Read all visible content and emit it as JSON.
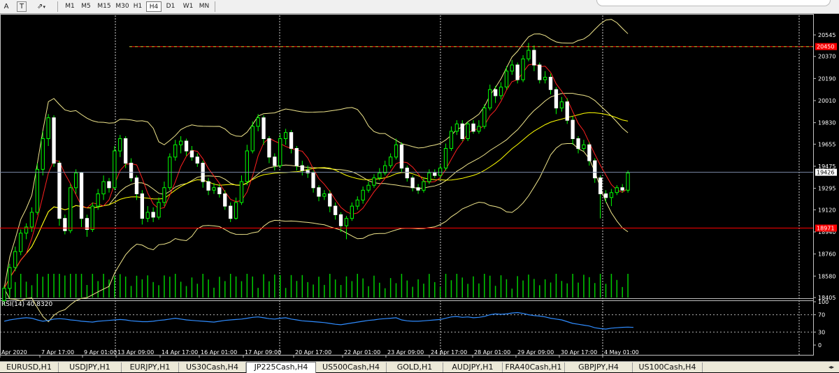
{
  "toolbar": {
    "tools": [
      {
        "name": "text-tool",
        "glyph": "A"
      },
      {
        "name": "text-label-tool",
        "glyph": "T"
      },
      {
        "name": "arrows-tool",
        "glyph": "⇗"
      }
    ],
    "timeframes": [
      {
        "label": "M1",
        "active": false
      },
      {
        "label": "M5",
        "active": false
      },
      {
        "label": "M15",
        "active": false
      },
      {
        "label": "M30",
        "active": false
      },
      {
        "label": "H1",
        "active": false
      },
      {
        "label": "H4",
        "active": true
      },
      {
        "label": "D1",
        "active": false
      },
      {
        "label": "W1",
        "active": false
      },
      {
        "label": "MN",
        "active": false
      }
    ]
  },
  "chart": {
    "price_labels": [
      "20545",
      "20370",
      "20190",
      "20010",
      "19830",
      "19655",
      "19475",
      "19295",
      "19120",
      "18940",
      "18760",
      "18580",
      "18405"
    ],
    "current_price_label": "19426",
    "upper_line_label": "20450",
    "lower_line_label": "18971",
    "date_labels": [
      "Apr 2020",
      "7 Apr 17:00",
      "9 Apr 01:00",
      "13 Apr 09:00",
      "14 Apr 17:00",
      "16 Apr 01:00",
      "17 Apr 09:00",
      "20 Apr 17:00",
      "22 Apr 01:00",
      "23 Apr 09:00",
      "24 Apr 17:00",
      "28 Apr 01:00",
      "29 Apr 09:00",
      "30 Apr 17:00",
      "4 May 01:00"
    ],
    "rsi_label": "RSI(14) 40.8320",
    "rsi_scale": [
      "100",
      "70",
      "30",
      "0"
    ],
    "colors": {
      "background": "#000000",
      "bull_candle": "#ffffff",
      "bear_candle": "#ffffff",
      "wick": "#00ff00",
      "bollinger": "#f0e68c",
      "ma_fast": "#ff2020",
      "ma_slow": "#ffff00",
      "volume": "#00cc00",
      "rsi_line": "#2f8cff",
      "hline": "#ff0000",
      "price_tag": "#ff0000"
    }
  },
  "chart_data": {
    "type": "candlestick",
    "y_range": [
      18405,
      20545
    ],
    "hlines": [
      20450,
      18971
    ],
    "current_price": 19426,
    "candles": [
      [
        18380,
        18480,
        18340,
        18500
      ],
      [
        18480,
        18650,
        18450,
        18680
      ],
      [
        18650,
        18780,
        18620,
        18820
      ],
      [
        18780,
        18930,
        18750,
        18960
      ],
      [
        18930,
        18980,
        18880,
        19010
      ],
      [
        18980,
        19100,
        18940,
        19140
      ],
      [
        19100,
        19450,
        19080,
        19500
      ],
      [
        19450,
        19700,
        19400,
        19760
      ],
      [
        19700,
        19870,
        19640,
        19900
      ],
      [
        19870,
        19500,
        19470,
        19890
      ],
      [
        19500,
        19050,
        18990,
        19520
      ],
      [
        19050,
        18950,
        18920,
        19080
      ],
      [
        18950,
        19300,
        18930,
        19330
      ],
      [
        19300,
        19420,
        19250,
        19450
      ],
      [
        19420,
        19050,
        18980,
        19430
      ],
      [
        19050,
        18960,
        18900,
        19080
      ],
      [
        18960,
        19150,
        18940,
        19180
      ],
      [
        19150,
        19250,
        19120,
        19290
      ],
      [
        19250,
        19350,
        19200,
        19400
      ],
      [
        19350,
        19300,
        19260,
        19380
      ],
      [
        19300,
        19600,
        19280,
        19640
      ],
      [
        19600,
        19700,
        19550,
        19730
      ],
      [
        19700,
        19500,
        19460,
        19720
      ],
      [
        19500,
        19380,
        19350,
        19540
      ],
      [
        19380,
        19250,
        19200,
        19400
      ],
      [
        19250,
        19050,
        19000,
        19280
      ],
      [
        19050,
        19100,
        19020,
        19150
      ],
      [
        19100,
        19060,
        19020,
        19140
      ],
      [
        19060,
        19180,
        19040,
        19220
      ],
      [
        19180,
        19300,
        19150,
        19350
      ],
      [
        19300,
        19550,
        19280,
        19580
      ],
      [
        19550,
        19650,
        19520,
        19690
      ],
      [
        19650,
        19680,
        19580,
        19720
      ],
      [
        19680,
        19600,
        19560,
        19700
      ],
      [
        19600,
        19550,
        19520,
        19640
      ],
      [
        19550,
        19500,
        19470,
        19580
      ],
      [
        19500,
        19350,
        19300,
        19520
      ],
      [
        19350,
        19280,
        19240,
        19380
      ],
      [
        19280,
        19300,
        19250,
        19340
      ],
      [
        19300,
        19250,
        19220,
        19330
      ],
      [
        19250,
        19150,
        19120,
        19280
      ],
      [
        19150,
        19050,
        19020,
        19180
      ],
      [
        19050,
        19180,
        19040,
        19220
      ],
      [
        19180,
        19350,
        19160,
        19400
      ],
      [
        19350,
        19600,
        19320,
        19650
      ],
      [
        19600,
        19800,
        19580,
        19840
      ],
      [
        19800,
        19870,
        19760,
        19900
      ],
      [
        19870,
        19700,
        19650,
        19890
      ],
      [
        19700,
        19550,
        19500,
        19720
      ],
      [
        19550,
        19480,
        19440,
        19580
      ],
      [
        19480,
        19700,
        19460,
        19740
      ],
      [
        19700,
        19750,
        19650,
        19780
      ],
      [
        19750,
        19620,
        19580,
        19770
      ],
      [
        19620,
        19480,
        19440,
        19640
      ],
      [
        19480,
        19440,
        19400,
        19520
      ],
      [
        19440,
        19420,
        19380,
        19480
      ],
      [
        19420,
        19300,
        19260,
        19440
      ],
      [
        19300,
        19230,
        19190,
        19320
      ],
      [
        19230,
        19250,
        19200,
        19280
      ],
      [
        19250,
        19150,
        19100,
        19280
      ],
      [
        19150,
        19080,
        19040,
        19180
      ],
      [
        19080,
        18990,
        18940,
        19100
      ],
      [
        18990,
        19050,
        18880,
        19070
      ],
      [
        19050,
        19150,
        19030,
        19180
      ],
      [
        19150,
        19200,
        19120,
        19230
      ],
      [
        19200,
        19280,
        19170,
        19310
      ],
      [
        19280,
        19320,
        19260,
        19350
      ],
      [
        19320,
        19380,
        19300,
        19410
      ],
      [
        19380,
        19420,
        19360,
        19460
      ],
      [
        19420,
        19480,
        19400,
        19520
      ],
      [
        19480,
        19550,
        19460,
        19580
      ],
      [
        19550,
        19650,
        19530,
        19700
      ],
      [
        19650,
        19460,
        19430,
        19670
      ],
      [
        19460,
        19380,
        19350,
        19480
      ],
      [
        19380,
        19300,
        19270,
        19400
      ],
      [
        19300,
        19280,
        19250,
        19330
      ],
      [
        19280,
        19350,
        19260,
        19380
      ],
      [
        19350,
        19420,
        19330,
        19450
      ],
      [
        19420,
        19400,
        19380,
        19450
      ],
      [
        19400,
        19460,
        19380,
        19490
      ],
      [
        19460,
        19620,
        19440,
        19660
      ],
      [
        19620,
        19760,
        19600,
        19800
      ],
      [
        19760,
        19820,
        19730,
        19850
      ],
      [
        19820,
        19700,
        19680,
        19850
      ],
      [
        19700,
        19820,
        19680,
        19840
      ],
      [
        19820,
        19760,
        19740,
        19850
      ],
      [
        19760,
        19800,
        19740,
        19850
      ],
      [
        19800,
        19950,
        19780,
        19980
      ],
      [
        19950,
        20100,
        19930,
        20140
      ],
      [
        20100,
        20050,
        19990,
        20130
      ],
      [
        20050,
        20120,
        20020,
        20160
      ],
      [
        20120,
        20250,
        20100,
        20290
      ],
      [
        20250,
        20300,
        20220,
        20340
      ],
      [
        20300,
        20180,
        20150,
        20320
      ],
      [
        20180,
        20350,
        20160,
        20380
      ],
      [
        20350,
        20420,
        20330,
        20480
      ],
      [
        20420,
        20300,
        20250,
        20460
      ],
      [
        20300,
        20180,
        20150,
        20320
      ],
      [
        20180,
        20200,
        20150,
        20250
      ],
      [
        20200,
        20100,
        20060,
        20230
      ],
      [
        20100,
        19950,
        19900,
        20120
      ],
      [
        19950,
        20000,
        19920,
        20040
      ],
      [
        20000,
        19850,
        19820,
        20030
      ],
      [
        19850,
        19700,
        19650,
        19880
      ],
      [
        19700,
        19620,
        19580,
        19720
      ],
      [
        19620,
        19650,
        19600,
        19690
      ],
      [
        19650,
        19520,
        19480,
        19670
      ],
      [
        19520,
        19380,
        19340,
        19540
      ],
      [
        19380,
        19250,
        19050,
        19400
      ],
      [
        19250,
        19220,
        19180,
        19280
      ],
      [
        19220,
        19260,
        19150,
        19290
      ],
      [
        19260,
        19300,
        19240,
        19320
      ],
      [
        19300,
        19280,
        19260,
        19330
      ],
      [
        19280,
        19420,
        19260,
        19440
      ]
    ],
    "rsi_values": [
      55,
      58,
      60,
      62,
      63,
      62,
      58,
      55,
      57,
      60,
      61,
      60,
      58,
      57,
      55,
      54,
      53,
      55,
      56,
      57,
      58,
      59,
      58,
      56,
      55,
      54,
      54,
      55,
      57,
      58,
      60,
      62,
      60,
      58,
      57,
      56,
      55,
      54,
      53,
      55,
      57,
      58,
      59,
      60,
      62,
      64,
      65,
      63,
      61,
      60,
      62,
      63,
      60,
      58,
      56,
      55,
      54,
      53,
      52,
      50,
      48,
      47,
      49,
      51,
      53,
      55,
      57,
      58,
      60,
      61,
      62,
      63,
      58,
      56,
      55,
      55,
      56,
      57,
      58,
      59,
      62,
      65,
      66,
      64,
      65,
      63,
      64,
      66,
      70,
      72,
      71,
      72,
      74,
      75,
      73,
      70,
      68,
      67,
      65,
      62,
      60,
      58,
      54,
      50,
      48,
      46,
      44,
      40,
      38,
      37,
      39,
      40,
      41,
      41.5,
      40.8
    ]
  },
  "tabs": [
    {
      "label": "EURUSD,H1",
      "active": false
    },
    {
      "label": "USDJPY,H1",
      "active": false
    },
    {
      "label": "EURJPY,H1",
      "active": false
    },
    {
      "label": "US30Cash,H4",
      "active": false
    },
    {
      "label": "JP225Cash,H4",
      "active": true
    },
    {
      "label": "US500Cash,H4",
      "active": false
    },
    {
      "label": "GOLD,H1",
      "active": false
    },
    {
      "label": "AUDJPY,H1",
      "active": false
    },
    {
      "label": "FRA40Cash,H1",
      "active": false
    },
    {
      "label": "GBPJPY,H4",
      "active": false
    },
    {
      "label": "US100Cash,H4",
      "active": false
    }
  ]
}
